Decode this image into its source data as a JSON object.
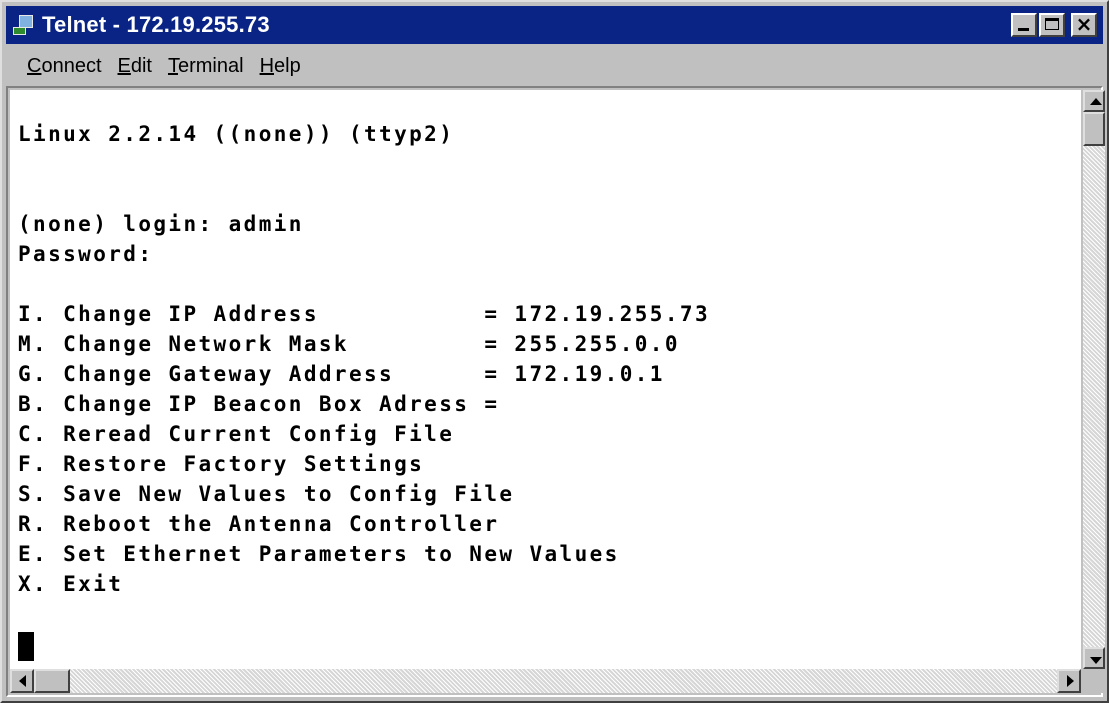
{
  "window": {
    "title": "Telnet - 172.19.255.73"
  },
  "menu": {
    "items": [
      {
        "mnemonic": "C",
        "rest": "onnect"
      },
      {
        "mnemonic": "E",
        "rest": "dit"
      },
      {
        "mnemonic": "T",
        "rest": "erminal"
      },
      {
        "mnemonic": "H",
        "rest": "elp"
      }
    ]
  },
  "terminal": {
    "lines": [
      "",
      "Linux 2.2.14 ((none)) (ttyp2)",
      "",
      "",
      "(none) login: admin",
      "Password:",
      "",
      "I. Change IP Address           = 172.19.255.73",
      "M. Change Network Mask         = 255.255.0.0",
      "G. Change Gateway Address      = 172.19.0.1",
      "B. Change IP Beacon Box Adress =",
      "C. Reread Current Config File",
      "F. Restore Factory Settings",
      "S. Save New Values to Config File",
      "R. Reboot the Antenna Controller",
      "E. Set Ethernet Parameters to New Values",
      "X. Exit"
    ]
  },
  "scrollbars": {
    "vertical_position": 0,
    "horizontal_position": 0
  }
}
